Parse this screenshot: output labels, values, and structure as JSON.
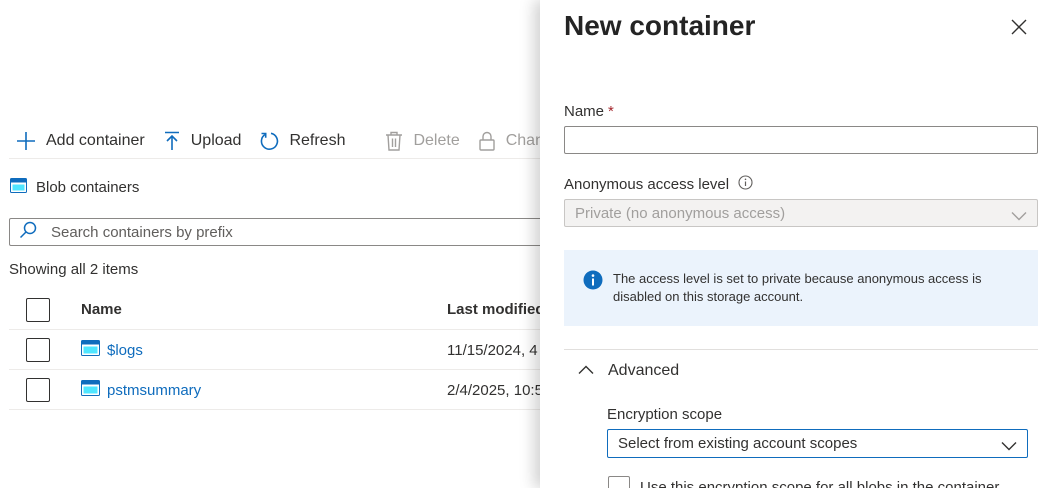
{
  "toolbar": {
    "add_container": "Add container",
    "upload": "Upload",
    "refresh": "Refresh",
    "delete": "Delete",
    "change": "Change access level"
  },
  "list": {
    "section_title": "Blob containers",
    "search_placeholder": "Search containers by prefix",
    "count_text": "Showing all 2 items",
    "columns": {
      "name": "Name",
      "last_modified": "Last modified"
    },
    "rows": [
      {
        "name": "$logs",
        "last_modified": "11/15/2024, 4"
      },
      {
        "name": "pstmsummary",
        "last_modified": "2/4/2025, 10:5"
      }
    ]
  },
  "panel": {
    "title": "New container",
    "name_label": "Name",
    "required_mark": "*",
    "name_value": "",
    "access_label": "Anonymous access level",
    "access_value": "Private (no anonymous access)",
    "info_text": "The access level is set to private because anonymous access is disabled on this storage account.",
    "advanced_label": "Advanced",
    "encryption_label": "Encryption scope",
    "encryption_value": "Select from existing account scopes",
    "scope_checkbox_label": "Use this encryption scope for all blobs in the container"
  },
  "colors": {
    "link": "#0f6cbd",
    "info_bg": "#ebf3fc",
    "required": "#a4262c",
    "info_icon": "#0f6cbd"
  },
  "icons": {
    "add": "plus-icon",
    "upload": "upload-arrow-icon",
    "refresh": "refresh-icon",
    "delete": "trash-icon",
    "change": "lock-icon",
    "container": "container-icon",
    "search": "search-icon",
    "close": "close-icon",
    "info": "info-icon",
    "chevron": "chevron-down-icon",
    "collapse": "chevron-up-icon"
  }
}
